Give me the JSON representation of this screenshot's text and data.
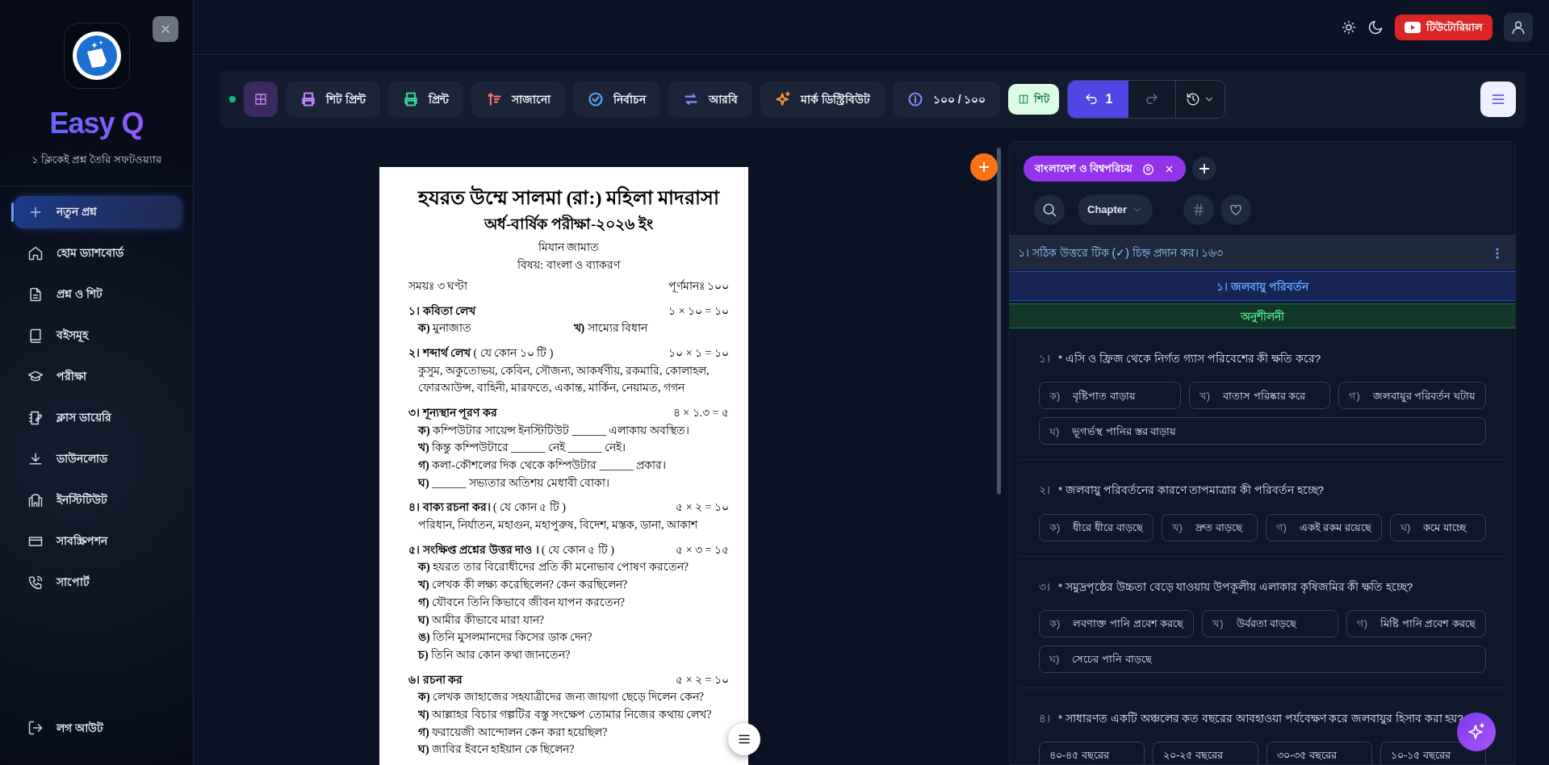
{
  "sidebar": {
    "brand": "Easy Q",
    "tagline": "১ ক্লিকেই প্রশ্ন তৈরি সফটওয়্যার",
    "items": [
      {
        "label": "নতুন প্রশ্ন",
        "selected": true
      },
      {
        "label": "হোম ড্যাশবোর্ড",
        "selected": false
      },
      {
        "label": "প্রশ্ন ও শিট",
        "selected": false
      },
      {
        "label": "বইসমূহ",
        "selected": false
      },
      {
        "label": "পরীক্ষা",
        "selected": false
      },
      {
        "label": "ক্লাস ডায়েরি",
        "selected": false
      },
      {
        "label": "ডাউনলোড",
        "selected": false
      },
      {
        "label": "ইনস্টিটিউট",
        "selected": false
      },
      {
        "label": "সাবস্ক্রিপশন",
        "selected": false
      },
      {
        "label": "সাপোর্ট",
        "selected": false
      }
    ],
    "logout": "লগ আউট"
  },
  "topbar": {
    "tutorial": "টিউটোরিয়াল"
  },
  "toolbar": {
    "layout_selected": true,
    "buttons": [
      {
        "label": "শিট প্রিন্ট",
        "color": "#c084fc"
      },
      {
        "label": "প্রিন্ট",
        "color": "#34d399"
      },
      {
        "label": "সাজানো",
        "color": "#f87171"
      },
      {
        "label": "নির্বাচন",
        "color": "#60a5fa"
      },
      {
        "label": "আরবি",
        "color": "#818cf8"
      },
      {
        "label": "মার্ক ডিস্ট্রিবিউট",
        "color": "#fb923c"
      },
      {
        "label": "১০০ / ১০০",
        "color": "#818cf8"
      }
    ],
    "sheet": {
      "label": "শিট",
      "on": true
    },
    "undo_count": "1",
    "redo_disabled": true
  },
  "paper": {
    "institution": "হযরত উম্মে সালমা (রা:) মহিলা মাদরাসা",
    "exam": "অর্ধ-বার্ষিক পরীক্ষা-২০২৬ ইং",
    "class": "মিযান জামাত",
    "subject": "বিষয়: বাংলা ও ব্যাকরণ",
    "time": "সময়ঃ ৩ ঘণ্টা",
    "full_marks": "পূর্ণমানঃ ১০০",
    "sections": [
      {
        "number": "১।",
        "title": "কবিতা লেখ",
        "marks": "১ × ১০ = ১০",
        "kind": "columns",
        "items": [
          {
            "label": "ক)",
            "text": "মুনাজাত"
          },
          {
            "label": "খ)",
            "text": "সাম্যের বিধান"
          }
        ]
      },
      {
        "number": "২।",
        "title": "শব্দার্থ লেখ",
        "note": "( যে কোন ১০ টি )",
        "marks": "১০ × ১ = ১০",
        "kind": "words",
        "text": "কুসুম, অকুতোভয়, কেবিন, সৌজন্য, আকর্ষণীয়, রকমারি, কোলাহল, ফোরআউন্স, বাহিনী, মারফতে, একান্ত, মার্কিন, নেয়ামত, গগন"
      },
      {
        "number": "৩।",
        "title": "শূন্যস্থান পূরণ কর",
        "marks": "৪ × ১.৩ = ৫",
        "kind": "list",
        "items": [
          {
            "label": "ক)",
            "text": "কম্পিউটার সায়েন্স ইনস্টিটিউট ______ এলাকায় অবস্থিত।"
          },
          {
            "label": "খ)",
            "text": "কিন্তু কম্পিউটারে ______ নেই ______ নেই।"
          },
          {
            "label": "গ)",
            "text": "কলা-কৌশলের দিক থেকে কম্পিউটার ______ প্রকার।"
          },
          {
            "label": "ঘ)",
            "text": "______ সভ্যতার অতিশয় মেধাবী বোকা।"
          }
        ]
      },
      {
        "number": "৪।",
        "title": "বাক্য রচনা কর।",
        "note": "( যে কোন ৫ টি )",
        "marks": "৫ × ২ = ১০",
        "kind": "words",
        "text": "পরিধান, নির্যাতন, মহাগুন, মহাপুরুষ, বিদেশ, মস্তক, ডানা, আকাশ"
      },
      {
        "number": "৫।",
        "title": "সংক্ষিপ্ত প্রশ্নের উত্তর দাও ।",
        "note": "( যে কোন ৫ টি )",
        "marks": "৫ × ৩ = ১৫",
        "kind": "list",
        "items": [
          {
            "label": "ক)",
            "text": "হযরত তার বিরোধীদের প্রতি কী মনোভাব পোষণ করতেন?"
          },
          {
            "label": "খ)",
            "text": "লেখক কী লক্ষ্য করেছিলেন? কেন করছিলেন?"
          },
          {
            "label": "গ)",
            "text": "যৌবনে তিনি কিভাবে জীবন যাপন করতেন?"
          },
          {
            "label": "ঘ)",
            "text": "আমীর কীভাবে মারা যান?"
          },
          {
            "label": "ঙ)",
            "text": "তিনি মুসলমানদের কিসের ডাক দেন?"
          },
          {
            "label": "চ)",
            "text": "তিনি আর কোন কথা জানতেন?"
          }
        ]
      },
      {
        "number": "৬।",
        "title": "রচনা কর",
        "marks": "৫ × ২ = ১০",
        "kind": "list",
        "items": [
          {
            "label": "ক)",
            "text": "লেখক জাহাজের সহযাত্রীদের জন্য জায়গা ছেড়ে দিলেন কেন?"
          },
          {
            "label": "খ)",
            "text": "আল্লাহর বিচার গল্পটির বস্তু সংক্ষেপ তোমার নিজের কথায় লেখ?"
          },
          {
            "label": "গ)",
            "text": "ফরায়েজী আন্দোলন কেন করা হয়েছিল?"
          },
          {
            "label": "ঘ)",
            "text": "জাবির ইবনে হাইয়ান কে ছিলেন?"
          }
        ]
      }
    ]
  },
  "panel": {
    "subject": "বাংলাদেশ ও বিশ্বপরিচয়",
    "chapter_filter": "Chapter",
    "instruction": "১। সঠিক উত্তরে টিক (✓) চিহ্ন প্রদান কর। ১৬৩",
    "chapter": "১। জলবায়ু পরিবর্তন",
    "section": "অনুশীলনী",
    "questions": [
      {
        "number": "১।",
        "text": "* এসি ও ফ্রিজ থেকে নির্গত গ্যাস পরিবেশের কী ক্ষতি করে?",
        "options": [
          {
            "label": "ক)",
            "text": "বৃষ্টিপাত বাড়ায়"
          },
          {
            "label": "খ)",
            "text": "বাতাস পরিষ্কার করে"
          },
          {
            "label": "গ)",
            "text": "জলবায়ুর পরিবর্তন ঘটায়"
          },
          {
            "label": "ঘ)",
            "text": "ভূগর্ভস্থ পানির স্তর বাড়ায়"
          }
        ]
      },
      {
        "number": "২।",
        "text": "* জলবায়ু পরিবর্তনের কারণে তাপমাত্রার কী পরিবর্তন হচ্ছে?",
        "options": [
          {
            "label": "ক)",
            "text": "ধীরে ধীরে বাড়ছে"
          },
          {
            "label": "খ)",
            "text": "দ্রুত বাড়ছে"
          },
          {
            "label": "গ)",
            "text": "একই রকম রয়েছে"
          },
          {
            "label": "ঘ)",
            "text": "কমে যাচ্ছে"
          }
        ]
      },
      {
        "number": "৩।",
        "text": "* সমুদ্রপৃষ্ঠের উচ্চতা বেড়ে যাওয়ায় উপকূলীয় এলাকার কৃষিজমির কী ক্ষতি হচ্ছে?",
        "options": [
          {
            "label": "ক)",
            "text": "লবণাক্ত পানি প্রবেশ করছে"
          },
          {
            "label": "খ)",
            "text": "উর্বরতা বাড়ছে"
          },
          {
            "label": "গ)",
            "text": "মিষ্টি পানি প্রবেশ করছে"
          },
          {
            "label": "ঘ)",
            "text": "সেচের পানি বাড়ছে"
          }
        ]
      },
      {
        "number": "৪।",
        "text": "* সাধারণত একটি অঞ্চলের কত বছরের আবহাওয়া পর্যবেক্ষণ করে জলবায়ুর হিসাব করা হয়?",
        "options": [
          {
            "text": "৪০-৪৫ বছরের"
          },
          {
            "text": "২০-২৫ বছরের"
          },
          {
            "text": "৩০-৩৫ বছরের"
          },
          {
            "text": "১০-১৫ বছরের"
          }
        ]
      }
    ]
  }
}
